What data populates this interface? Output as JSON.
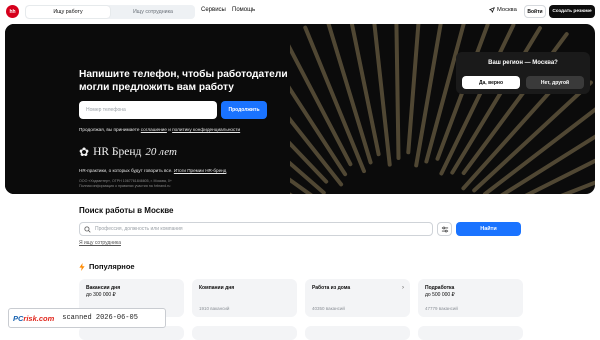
{
  "header": {
    "logo_text": "hh",
    "tabs": [
      {
        "label": "Ищу работу",
        "active": true
      },
      {
        "label": "Ищу сотрудника",
        "active": false
      }
    ],
    "nav": [
      "Сервисы",
      "Помощь"
    ],
    "region": "Москва",
    "login_label": "Войти",
    "create_resume_label": "Создать резюме"
  },
  "region_popup": {
    "title": "Ваш регион — Москва?",
    "yes_label": "Да, верно",
    "no_label": "Нет, другой"
  },
  "hero": {
    "title": "Напишите телефон, чтобы работодатели могли предложить вам работу",
    "phone_placeholder": "Номер телефона",
    "continue_label": "Продолжить",
    "consent_prefix": "Продолжая, вы принимаете ",
    "consent_link1": "соглашение",
    "consent_mid": " и ",
    "consent_link2": "политику конфиденциальности",
    "brand_text": "HR Бренд",
    "brand_years": "20 лет",
    "hr_note_prefix": "HR-практики, о которых будут говорить все. ",
    "hr_note_link": "Итоги Премии HR-бренд",
    "legal_line1": "ООО «Хэдхантер», ОГРН 1067761846605, г. Москва, 0+",
    "legal_line2": "Полная информация о правилах участия на hrbrand.ru"
  },
  "search": {
    "title": "Поиск работы в Москве",
    "placeholder": "Профессия, должность или компания",
    "find_label": "Найти",
    "seek_employee_label": "Я ищу сотрудника"
  },
  "popular": {
    "title": "Популярное",
    "cards": [
      {
        "title": "Вакансии дня",
        "subtitle": "до 300 000 ₽",
        "count": ""
      },
      {
        "title": "Компании дня",
        "subtitle": "",
        "count": "1910 вакансий"
      },
      {
        "title": "Работа из дома",
        "subtitle": "",
        "count": "40350 вакансий"
      },
      {
        "title": "Подработка",
        "subtitle": "до 500 000 ₽",
        "count": "47779 вакансий"
      }
    ]
  },
  "watermark": {
    "logo_pc": "PC",
    "logo_risk": "risk.com",
    "text": "scanned 2026-06-05"
  },
  "colors": {
    "accent": "#1a73ff",
    "hero_bg": "#0b0b0b",
    "brand_red": "#d6001c"
  }
}
